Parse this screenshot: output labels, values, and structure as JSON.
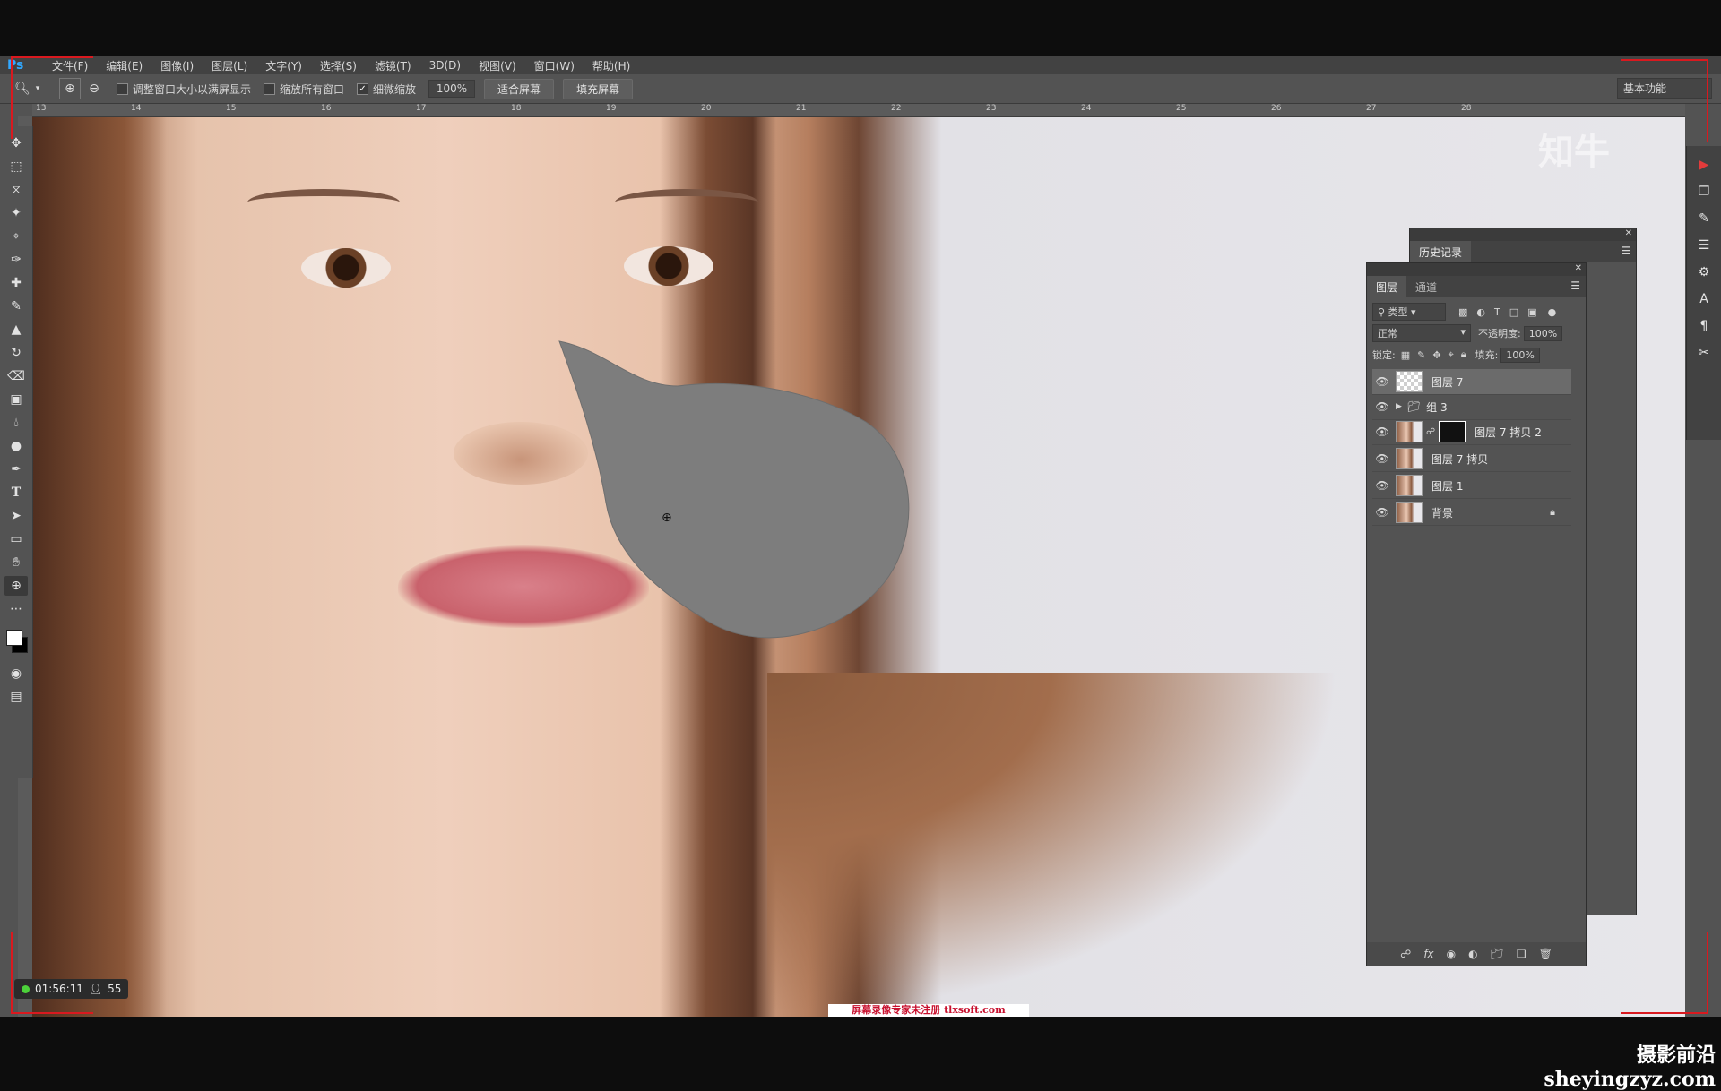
{
  "app": {
    "logo": "Ps"
  },
  "menu": [
    "文件(F)",
    "编辑(E)",
    "图像(I)",
    "图层(L)",
    "文字(Y)",
    "选择(S)",
    "滤镜(T)",
    "3D(D)",
    "视图(V)",
    "窗口(W)",
    "帮助(H)"
  ],
  "options": {
    "resize_windows": {
      "label": "调整窗口大小以满屏显示",
      "checked": false
    },
    "zoom_all": {
      "label": "缩放所有窗口",
      "checked": false
    },
    "scrubby_zoom": {
      "label": "细微缩放",
      "checked": true
    },
    "zoom_value": "100%",
    "fit_screen": "适合屏幕",
    "fill_screen": "填充屏幕",
    "workspace": "基本功能"
  },
  "ruler": [
    "13",
    "14",
    "15",
    "16",
    "17",
    "18",
    "19",
    "20",
    "21",
    "22",
    "23",
    "24",
    "25",
    "26",
    "27",
    "28"
  ],
  "watermark": "知牛",
  "history_panel": {
    "title": "历史记录"
  },
  "layers_panel": {
    "tabs": [
      "图层",
      "通道"
    ],
    "filter": "类型",
    "blend": "正常",
    "opacity_label": "不透明度:",
    "opacity": "100%",
    "lock_label": "锁定:",
    "fill_label": "填充:",
    "fill": "100%",
    "layers": [
      {
        "name": "图层 7",
        "thumb": "trans",
        "selected": true
      },
      {
        "name": "组 3",
        "thumb": "folder"
      },
      {
        "name": "图层 7 拷贝 2",
        "thumb": "face",
        "mask": true
      },
      {
        "name": "图层 7 拷贝",
        "thumb": "face"
      },
      {
        "name": "图层 1",
        "thumb": "face"
      },
      {
        "name": "背景",
        "thumb": "face",
        "locked": true
      }
    ]
  },
  "status": {
    "time": "01:56:11",
    "viewers": "55"
  },
  "overlay_banner": "屏幕录像专家未注册 tlxsoft.com",
  "corner_watermark": "摄影前沿 sheyingzyz.com",
  "colors": {
    "accent": "#31a8ff",
    "panel": "#535353",
    "banner": "#c8102e"
  }
}
